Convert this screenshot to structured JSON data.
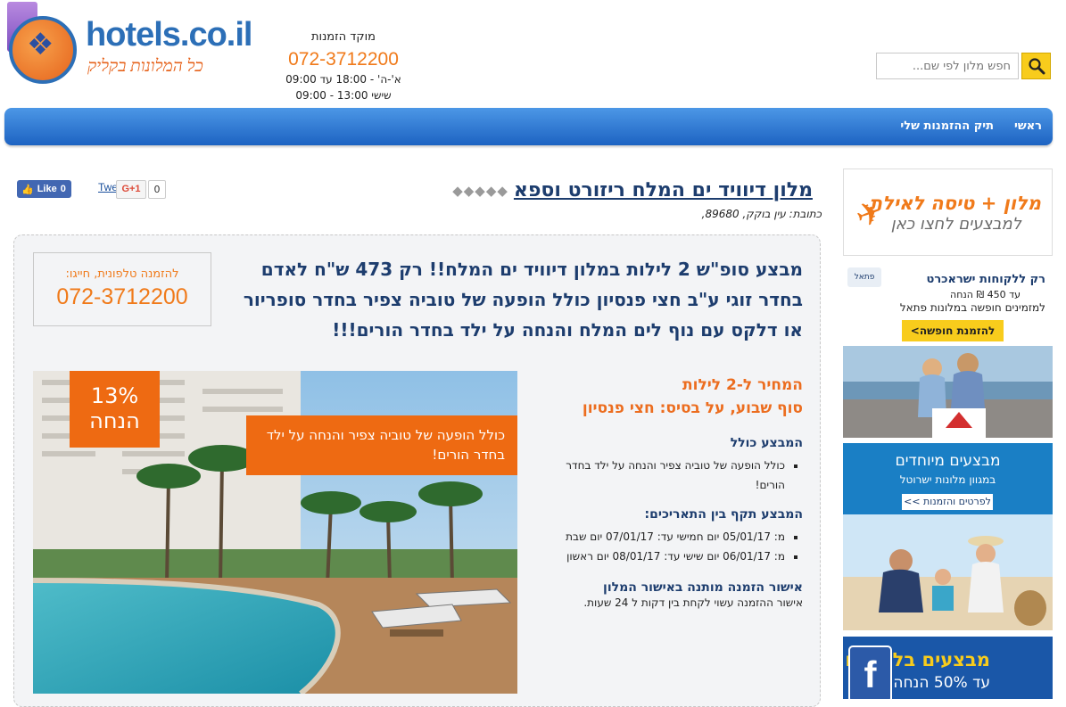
{
  "header": {
    "logo_text": "hotels.co.il",
    "logo_slogan": "כל המלונות בקליק",
    "call_center_title": "מוקד הזמנות",
    "call_center_phone": "072-3712200",
    "hours_weekdays": "א'-ה' - 18:00 עד 09:00",
    "hours_friday": "שישי 13:00 - 09:00"
  },
  "search": {
    "placeholder": "חפש מלון לפי שם..."
  },
  "nav": {
    "items": [
      "ראשי",
      "תיק ההזמנות שלי"
    ]
  },
  "social": {
    "fb_like": "Like",
    "fb_count": "0",
    "tweet": "Tweet",
    "gplus": "G+1",
    "gplus_count": "0"
  },
  "hotel": {
    "name": "מלון דיוויד ים המלח ריזורט וספא",
    "stars": 5,
    "address": "כתובת: עין בוקק, 89680,"
  },
  "phone_box": {
    "label": "להזמנה טלפונית, חייגו:",
    "phone": "072-3712200"
  },
  "deal": {
    "headline": "מבצע סופ\"ש 2 לילות במלון דיוויד ים המלח!! רק 473 ש\"ח לאדם בחדר זוגי ע\"ב חצי פנסיון כולל הופעה של טוביה צפיר בחדר סופריור או דלקס עם נוף לים המלח והנחה על ילד בחדר הורים!!!",
    "discount_percent": "13%",
    "discount_word": "הנחה",
    "ribbon": "כולל הופעה של טוביה צפיר והנחה על ילד בחדר הורים!",
    "price_line1": "המחיר ל-2 לילות",
    "price_line2": "סוף שבוע, על בסיס: חצי פנסיון",
    "includes_title": "המבצע כולל",
    "includes": [
      "כולל הופעה של טוביה צפיר והנחה על ילד בחדר הורים!"
    ],
    "dates_title": "המבצע תקף בין התאריכים:",
    "dates": [
      "מ: 05/01/17 יום חמישי עד: 07/01/17 יום שבת",
      "מ: 06/01/17 יום שישי עד: 08/01/17 יום ראשון"
    ],
    "confirm_title": "אישור הזמנה מותנה באישור המלון",
    "confirm_text": "אישור ההזמנה עשוי לקחת בין דקות ל 24 שעות."
  },
  "ads": {
    "ad1": {
      "line1": "מלון + טיסה לאילת",
      "line2": "למבצעים לחצו כאן"
    },
    "ad2": {
      "line1": "רק ללקוחות ישראכרט",
      "line2": "עד 450 ₪ הנחה",
      "line3": "למזמינים חופשה במלונות פתאל",
      "button": "להזמנת חופשה>",
      "logo": "פתאל",
      "brand": "ישראכרט"
    },
    "ad3": {
      "line1": "מבצעים מיוחדים",
      "line2": "במגוון מלונות ישרוטל",
      "button": "לפרטים והזמנות >>"
    },
    "ad4": {
      "line1": "מבצעים בלעדיים",
      "line2": "עד 50% הנחה",
      "fb": "f"
    }
  },
  "colors": {
    "accent_orange": "#ee6a12",
    "navy": "#1d3d6e",
    "nav_blue": "#1d63c2",
    "search_yellow": "#f8cc1c"
  }
}
